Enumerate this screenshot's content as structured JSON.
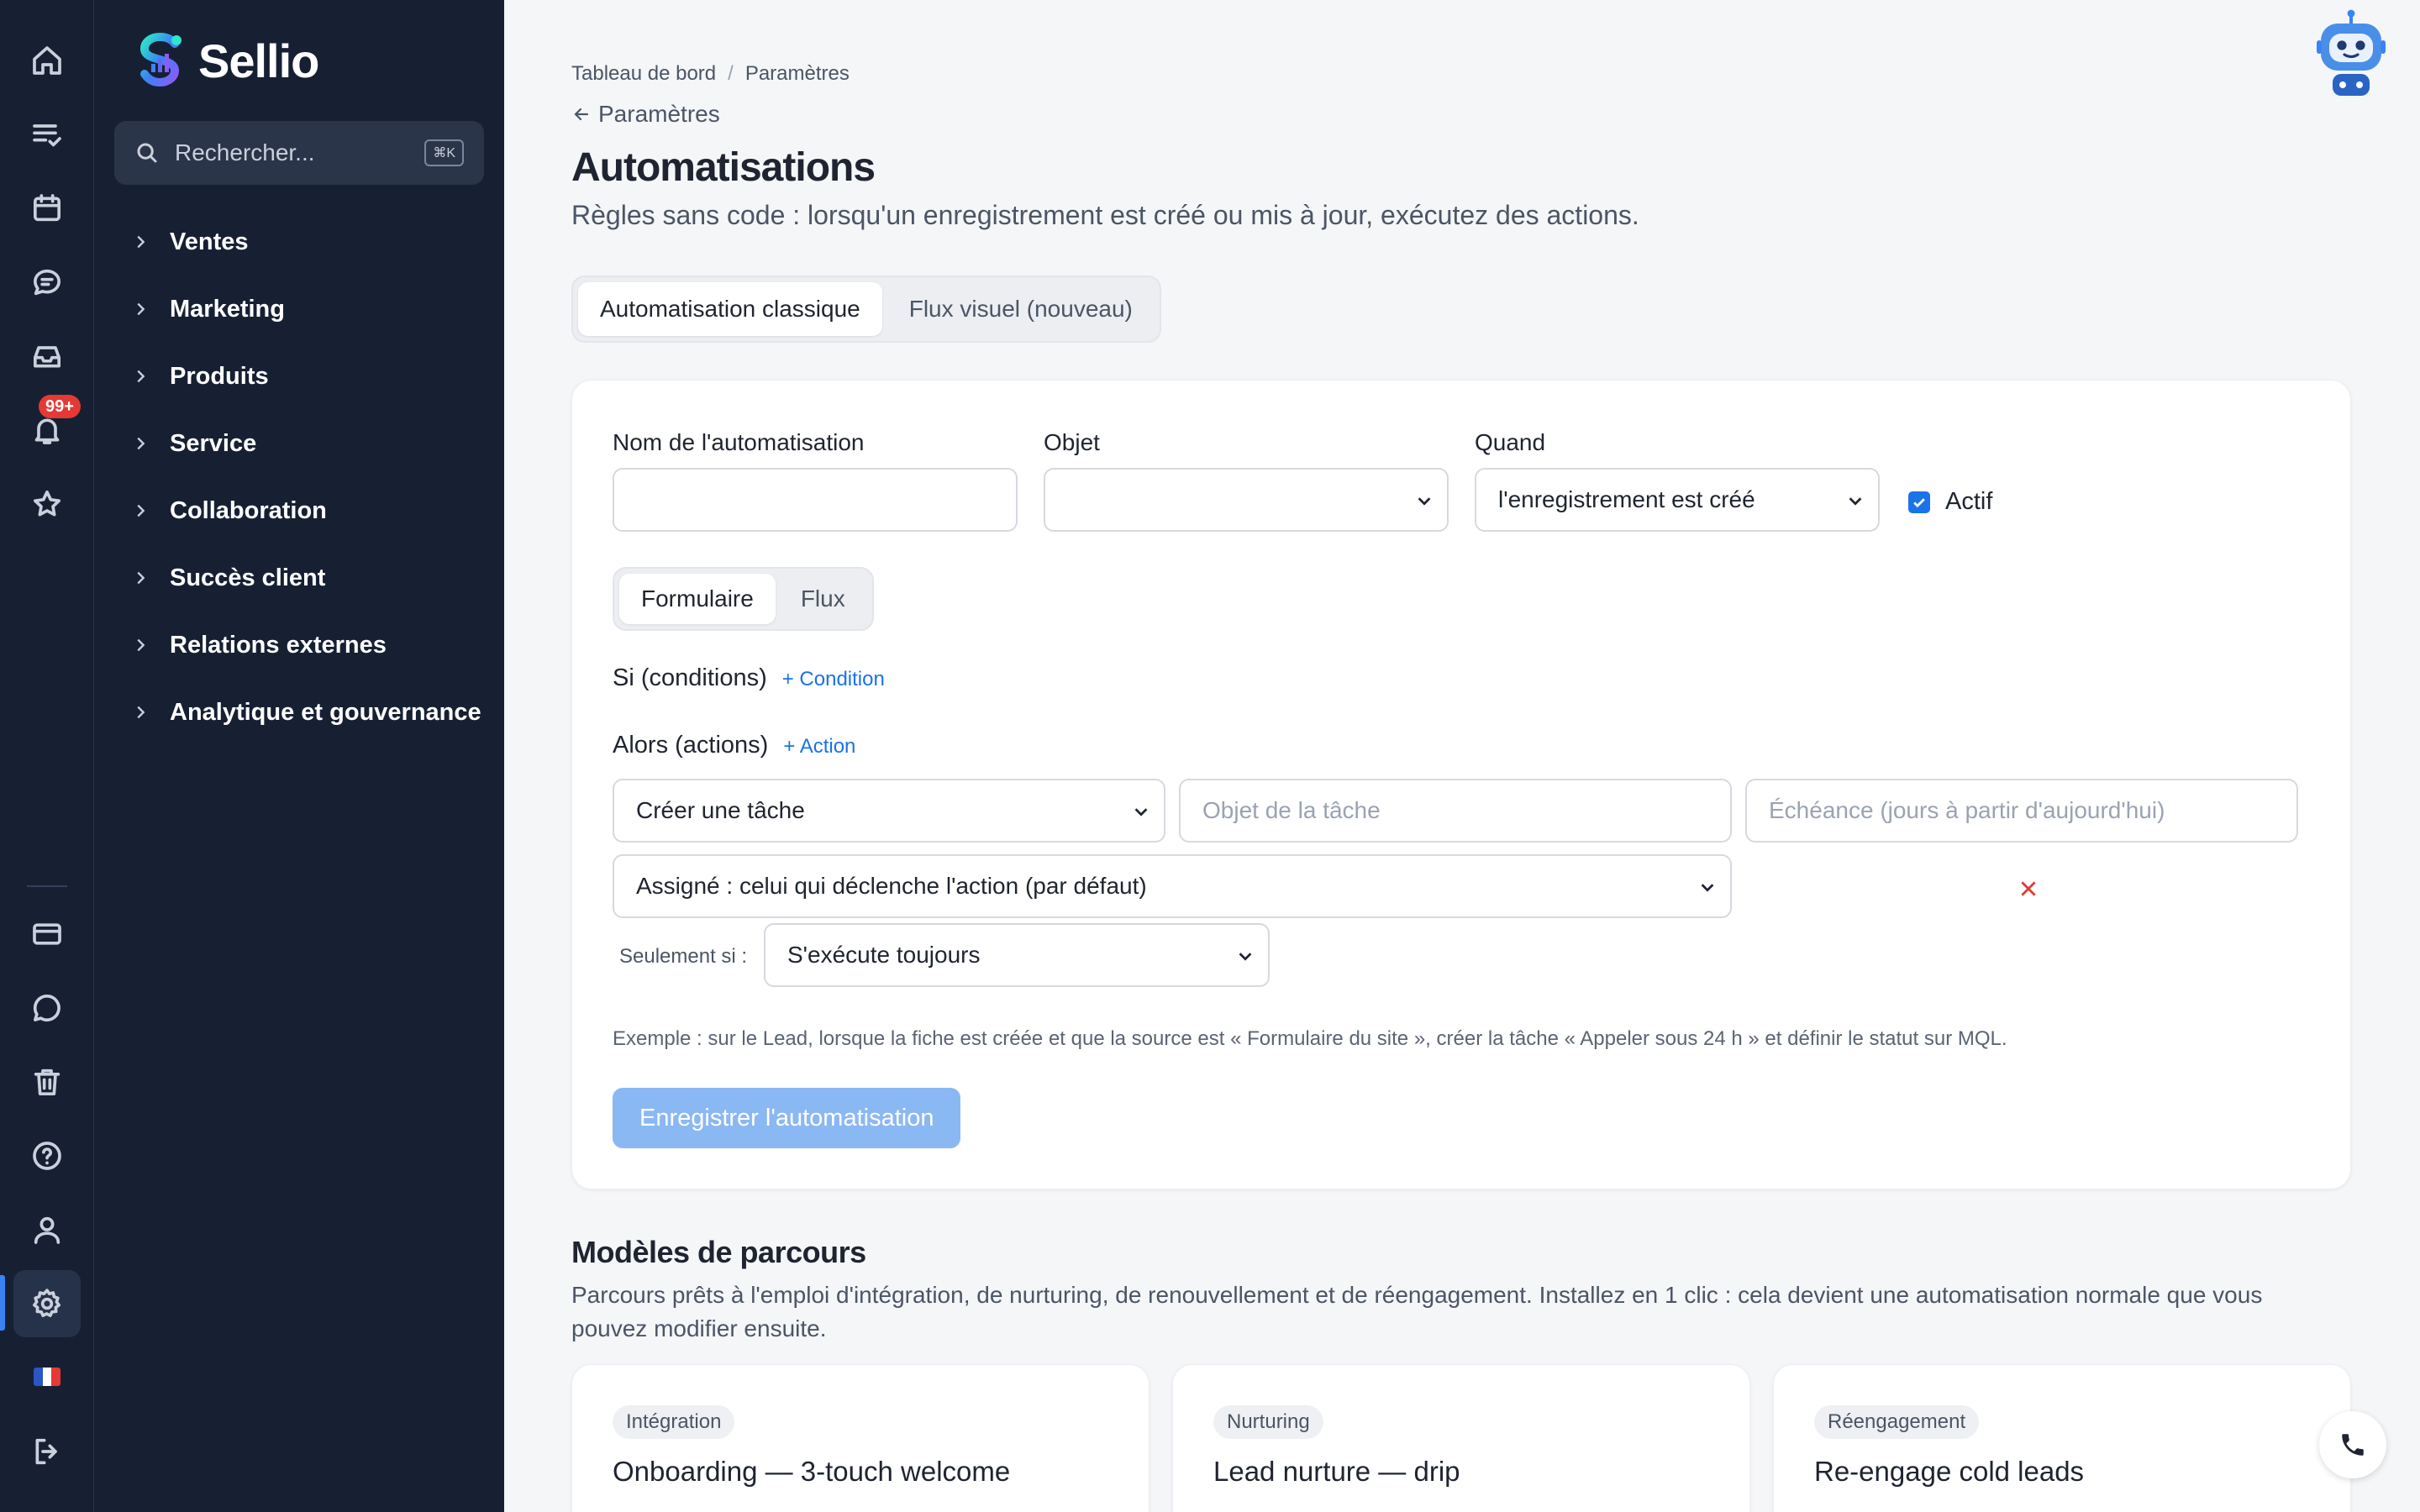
{
  "app": {
    "name": "Sellio",
    "notifications_badge": "99+",
    "locale_flag": "fr"
  },
  "search": {
    "placeholder": "Rechercher...",
    "shortcut": "⌘K"
  },
  "nav": {
    "items": [
      {
        "label": "Ventes"
      },
      {
        "label": "Marketing"
      },
      {
        "label": "Produits"
      },
      {
        "label": "Service"
      },
      {
        "label": "Collaboration"
      },
      {
        "label": "Succès client"
      },
      {
        "label": "Relations externes"
      },
      {
        "label": "Analytique et gouvernance"
      }
    ]
  },
  "breadcrumb": {
    "first": "Tableau de bord",
    "separator": "/",
    "second": "Paramètres"
  },
  "back_link": "Paramètres",
  "page": {
    "title": "Automatisations",
    "subtitle": "Règles sans code : lorsqu'un enregistrement est créé ou mis à jour, exécutez des actions."
  },
  "tabs": [
    {
      "label": "Automatisation classique",
      "active": true
    },
    {
      "label": "Flux visuel (nouveau)",
      "active": false
    }
  ],
  "form": {
    "name_label": "Nom de l'automatisation",
    "name_value": "",
    "object_label": "Objet",
    "object_value": "",
    "when_label": "Quand",
    "when_value": "l'enregistrement est créé",
    "active_label": "Actif",
    "active_checked": true,
    "mode_tabs": [
      {
        "label": "Formulaire",
        "active": true
      },
      {
        "label": "Flux",
        "active": false
      }
    ],
    "conditions_title": "Si (conditions)",
    "add_condition": "+ Condition",
    "actions_title": "Alors (actions)",
    "add_action": "+ Action",
    "action_type": "Créer une tâche",
    "task_subject_placeholder": "Objet de la tâche",
    "due_placeholder": "Échéance (jours à partir d'aujourd'hui)",
    "assignee": "Assigné : celui qui déclenche l'action (par défaut)",
    "only_if_label": "Seulement si :",
    "only_if_value": "S'exécute toujours",
    "example": "Exemple : sur le Lead, lorsque la fiche est créée et que la source est « Formulaire du site », créer la tâche « Appeler sous 24 h » et définir le statut sur MQL.",
    "save_label": "Enregistrer l'automatisation"
  },
  "templates": {
    "title": "Modèles de parcours",
    "description": "Parcours prêts à l'emploi d'intégration, de nurturing, de renouvellement et de réengagement. Installez en 1 clic : cela devient une automatisation normale que vous pouvez modifier ensuite.",
    "cards": [
      {
        "tag": "Intégration",
        "name": "Onboarding — 3-touch welcome"
      },
      {
        "tag": "Nurturing",
        "name": "Lead nurture — drip"
      },
      {
        "tag": "Réengagement",
        "name": "Re-engage cold leads"
      }
    ]
  },
  "colors": {
    "sidebar_bg": "#172033",
    "accent": "#1a73e8",
    "save_disabled": "#8ab8f3",
    "danger": "#e53935",
    "page_bg": "#f5f6f8"
  },
  "icons": {
    "rail": [
      "home-icon",
      "tasks-icon",
      "calendar-icon",
      "chat-icon",
      "inbox-icon",
      "bell-icon",
      "star-icon",
      "billing-icon",
      "message-icon",
      "trash-icon",
      "help-icon",
      "user-icon",
      "settings-icon",
      "logout-icon"
    ]
  }
}
